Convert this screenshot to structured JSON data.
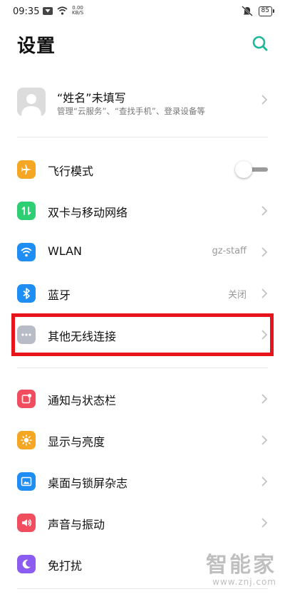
{
  "status_bar": {
    "time": "09:35",
    "speed_value": "0.00",
    "speed_unit": "KB/S",
    "battery": "85",
    "icons": [
      "notification-icon",
      "wifi-icon",
      "mute-icon",
      "battery-icon"
    ]
  },
  "header": {
    "title": "设置",
    "accent_color": "#1fb89a"
  },
  "profile": {
    "name": "“姓名”未填写",
    "subtitle": "管理“云服务”、“查找手机”、登录设备等"
  },
  "settings": [
    {
      "id": "airplane",
      "label": "飞行模式",
      "icon": "airplane-icon",
      "color": "#f5a623",
      "toggle": false
    },
    {
      "id": "sim",
      "label": "双卡与移动网络",
      "icon": "sim-network-icon",
      "color": "#2ecf73"
    },
    {
      "id": "wlan",
      "label": "WLAN",
      "icon": "wifi-icon",
      "color": "#1e8ef5",
      "value": "gz-staff"
    },
    {
      "id": "bluetooth",
      "label": "蓝牙",
      "icon": "bluetooth-icon",
      "color": "#1e8ef5",
      "value": "关闭"
    },
    {
      "id": "other-wireless",
      "label": "其他无线连接",
      "icon": "more-dots-icon",
      "color": "#b8bcc6"
    },
    {
      "id": "notification",
      "label": "通知与状态栏",
      "icon": "notification-bar-icon",
      "color": "#f04e5e"
    },
    {
      "id": "display",
      "label": "显示与亮度",
      "icon": "brightness-icon",
      "color": "#f5a623"
    },
    {
      "id": "desktop",
      "label": "桌面与锁屏杂志",
      "icon": "wallpaper-icon",
      "color": "#1e8ef5"
    },
    {
      "id": "sound",
      "label": "声音与振动",
      "icon": "sound-icon",
      "color": "#f04e5e"
    },
    {
      "id": "dnd",
      "label": "免打扰",
      "icon": "moon-icon",
      "color": "#8c5cf0"
    }
  ],
  "highlight_color": "#e8141c",
  "watermark": {
    "main": "智能家",
    "sub": "www.znj.com"
  }
}
